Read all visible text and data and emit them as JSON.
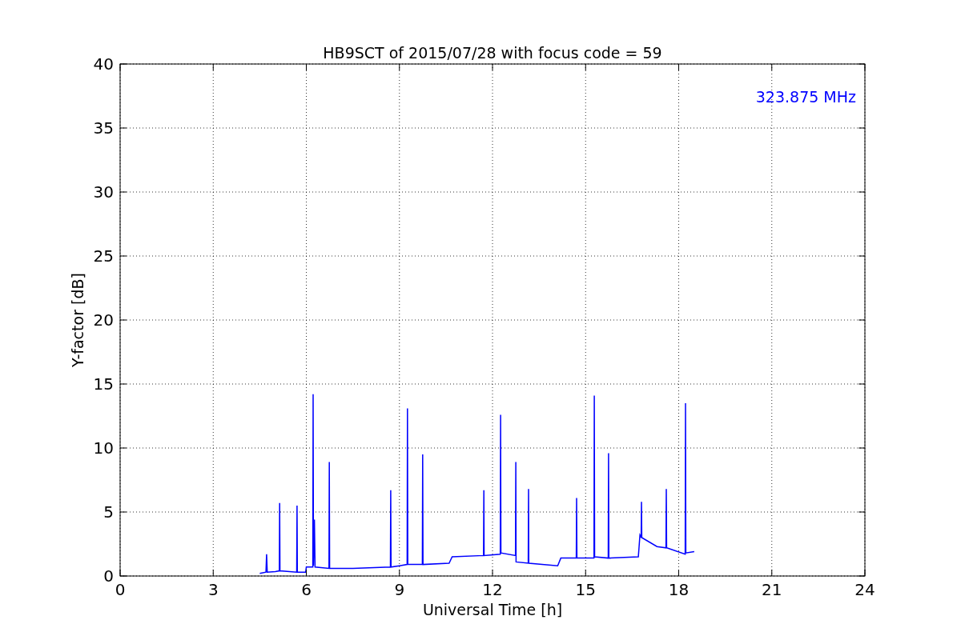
{
  "chart_data": {
    "type": "line",
    "title": "HB9SCT of 2015/07/28 with focus code = 59",
    "xlabel": "Universal Time [h]",
    "ylabel": "Y-factor [dB]",
    "xlim": [
      0,
      24
    ],
    "ylim": [
      0,
      40
    ],
    "xticks": [
      0,
      3,
      6,
      9,
      12,
      15,
      18,
      21,
      24
    ],
    "yticks": [
      0,
      5,
      10,
      15,
      20,
      25,
      30,
      35,
      40
    ],
    "x": [
      4.5,
      4.7,
      4.72,
      4.74,
      5.0,
      5.13,
      5.14,
      5.15,
      5.69,
      5.7,
      5.71,
      5.98,
      6.0,
      6.21,
      6.22,
      6.23,
      6.26,
      6.28,
      6.73,
      6.74,
      6.75,
      7.5,
      8.71,
      8.72,
      8.73,
      9.0,
      9.25,
      9.26,
      9.27,
      9.74,
      9.75,
      9.76,
      10.6,
      10.7,
      11.71,
      11.72,
      11.73,
      12.25,
      12.26,
      12.27,
      12.74,
      12.75,
      12.76,
      13.15,
      13.16,
      13.17,
      14.1,
      14.2,
      14.7,
      14.71,
      14.72,
      15.27,
      15.28,
      15.29,
      15.73,
      15.74,
      15.75,
      16.7,
      16.75,
      16.79,
      16.8,
      16.81,
      17.3,
      17.59,
      17.6,
      17.61,
      18.21,
      18.22,
      18.23,
      18.5
    ],
    "series": [
      {
        "name": "323.875 MHz",
        "color": "#0000ff",
        "values": [
          0.2,
          0.3,
          1.7,
          0.3,
          0.35,
          0.4,
          5.7,
          0.4,
          0.3,
          5.5,
          0.3,
          0.3,
          0.7,
          0.7,
          14.2,
          0.8,
          4.4,
          0.7,
          0.6,
          8.9,
          0.6,
          0.6,
          0.7,
          6.7,
          0.7,
          0.8,
          0.9,
          13.1,
          0.9,
          0.9,
          9.5,
          0.9,
          1.0,
          1.5,
          1.6,
          6.7,
          1.6,
          1.7,
          12.6,
          1.8,
          1.6,
          8.9,
          1.1,
          1.0,
          6.8,
          1.0,
          0.8,
          1.4,
          1.4,
          6.1,
          1.4,
          1.4,
          14.1,
          1.5,
          1.4,
          9.6,
          1.4,
          1.5,
          3.2,
          3.0,
          5.8,
          3.0,
          2.3,
          2.2,
          6.8,
          2.2,
          1.7,
          13.5,
          1.8,
          1.9
        ]
      }
    ],
    "grid": true
  }
}
